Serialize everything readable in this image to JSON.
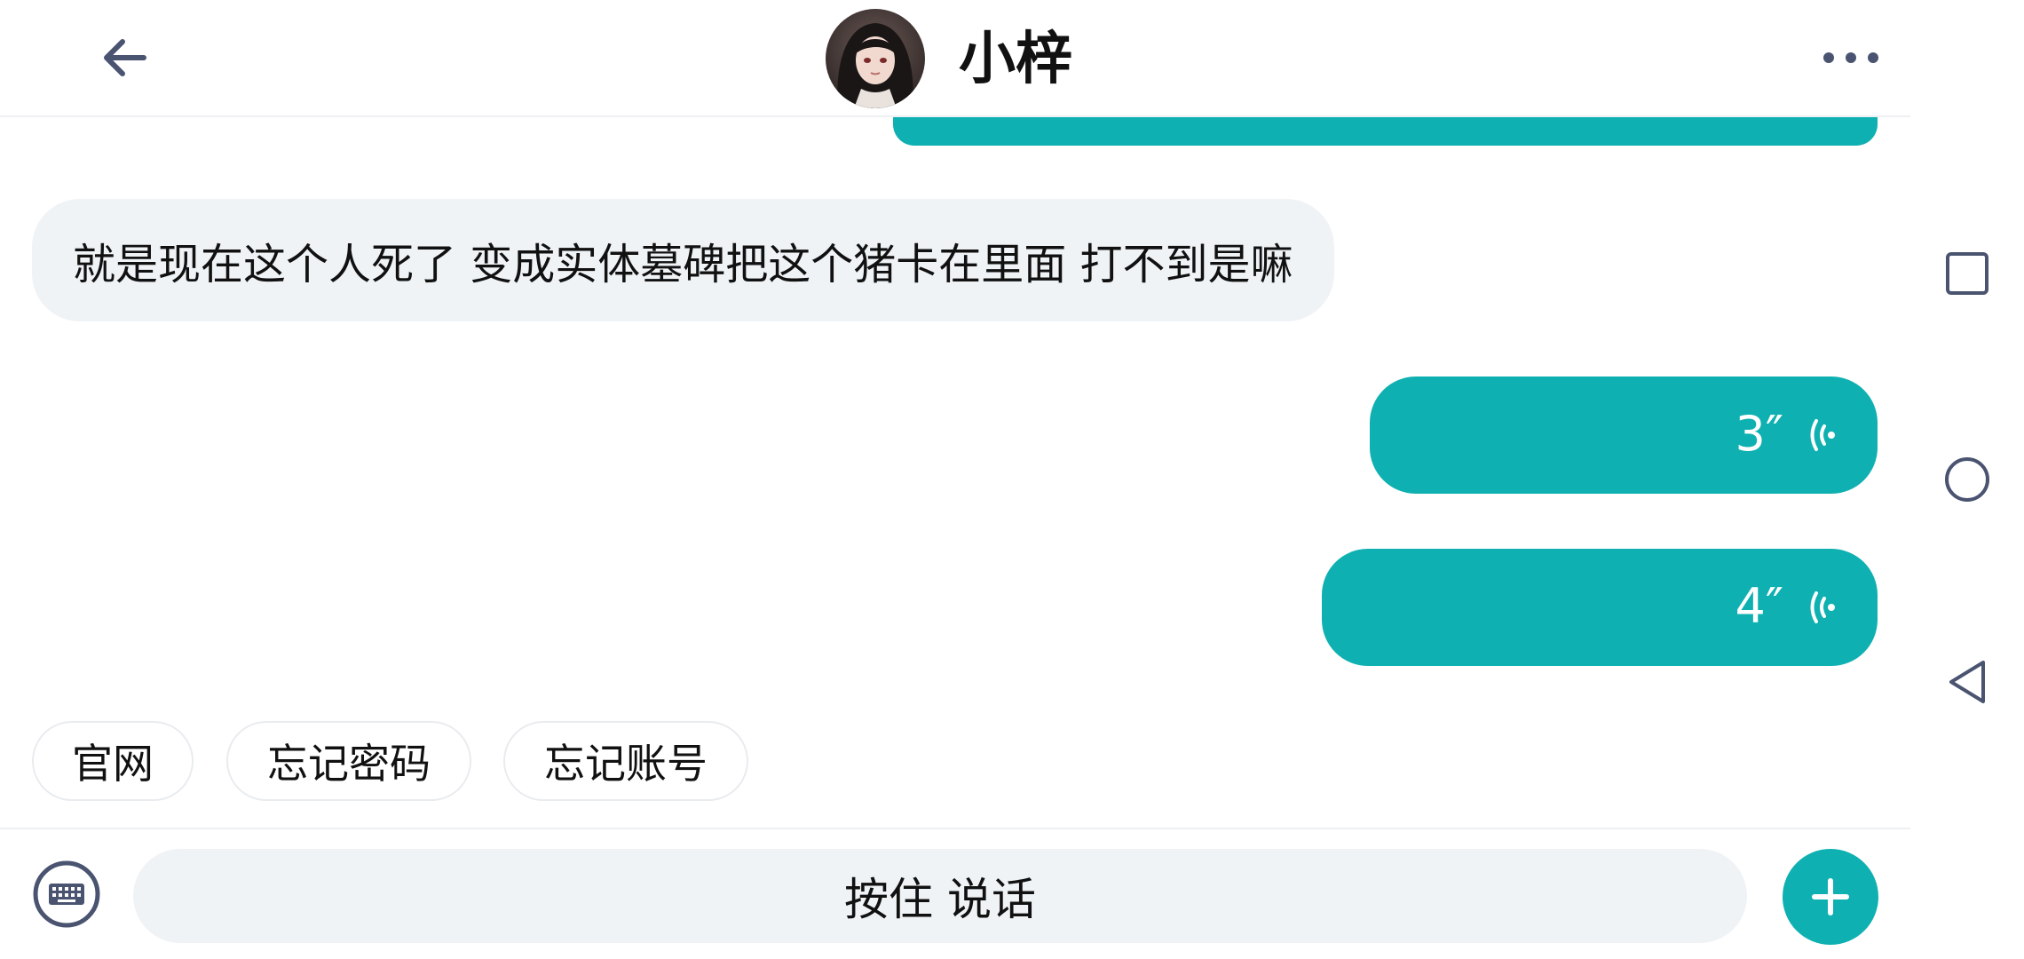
{
  "header": {
    "title": "小梓",
    "back_icon": "arrow-left-icon",
    "more_icon": "more-horizontal-icon"
  },
  "messages": {
    "incoming_text": "就是现在这个人死了 变成实体墓碑把这个猪卡在里面 打不到是嘛",
    "voice_1_duration": "3″",
    "voice_2_duration": "4″"
  },
  "quick_replies": [
    "官网",
    "忘记密码",
    "忘记账号"
  ],
  "input": {
    "hold_to_talk_label": "按住 说话",
    "keyboard_icon": "keyboard-icon",
    "plus_icon": "plus-icon"
  },
  "navbar": {
    "recents_icon": "square-icon",
    "home_icon": "circle-icon",
    "back_icon": "triangle-back-icon"
  },
  "colors": {
    "accent": "#0fb0b1",
    "bubble_gray": "#f0f3f6",
    "icon_gray": "#4a5470"
  }
}
